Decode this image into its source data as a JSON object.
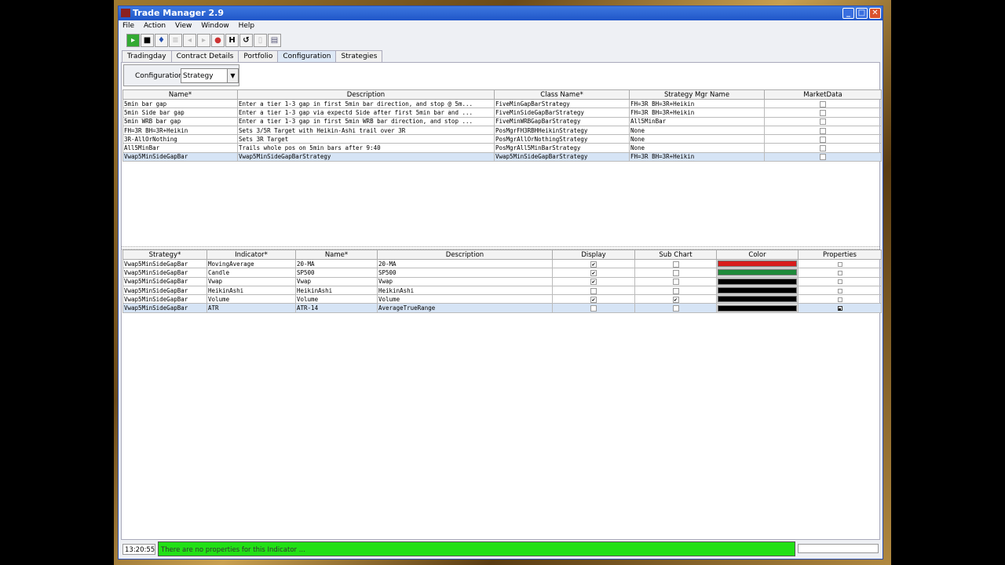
{
  "window": {
    "title": "Trade Manager 2.9"
  },
  "menu": [
    "File",
    "Action",
    "View",
    "Window",
    "Help"
  ],
  "toolbar": [
    "open-icon",
    "save-icon",
    "connect-icon",
    "delete-icon",
    "back-icon",
    "forward-icon",
    "stop-icon",
    "heikin-icon",
    "refresh-icon",
    "clipboard-icon",
    "print-icon"
  ],
  "tabs": [
    {
      "label": "Tradingday"
    },
    {
      "label": "Contract Details"
    },
    {
      "label": "Portfolio"
    },
    {
      "label": "Configuration",
      "selected": true
    },
    {
      "label": "Strategies"
    }
  ],
  "config": {
    "label": "Configuration:",
    "value": "Strategy"
  },
  "strategy_table": {
    "headers": [
      "Name*",
      "Description",
      "Class Name*",
      "Strategy Mgr Name",
      "MarketData"
    ],
    "rows": [
      [
        "5min bar gap",
        "Enter a tier 1-3 gap in first 5min bar direction, and stop @ 5m...",
        "FiveMinGapBarStrategy",
        "FH=3R BH=3R+Heikin",
        false
      ],
      [
        "5min Side bar gap",
        "Enter a tier 1-3 gap via expectd Side after first 5min bar and ...",
        "FiveMinSideGapBarStrategy",
        "FH=3R BH=3R+Heikin",
        false
      ],
      [
        "5min WRB bar gap",
        "Enter a tier 1-3 gap in first 5min WRB bar direction, and stop ...",
        "FiveMinWRBGapBarStrategy",
        "All5MinBar",
        false
      ],
      [
        "FH=3R BH=3R+Heikin",
        "Sets 3/5R Target with Heikin-Ashi trail over 3R",
        "PosMgrFH3RBHHeikinStrategy",
        "None",
        false
      ],
      [
        "3R-AllOrNothing",
        "Sets 3R Target",
        "PosMgrAllOrNothingStrategy",
        "None",
        false
      ],
      [
        "All5MinBar",
        "Trails whole pos on 5min bars after 9:40",
        "PosMgrAll5MinBarStrategy",
        "None",
        false
      ],
      [
        "Vwap5MinSideGapBar",
        "Vwap5MinSideGapBarStrategy",
        "Vwap5MinSideGapBarStrategy",
        "FH=3R BH=3R+Heikin",
        false
      ]
    ],
    "selected_row": 6
  },
  "indicator_table": {
    "headers": [
      "Strategy*",
      "Indicator*",
      "Name*",
      "Description",
      "Display",
      "Sub Chart",
      "Color",
      "Properties"
    ],
    "rows": [
      [
        "Vwap5MinSideGapBar",
        "MovingAverage",
        "20-MA",
        "20-MA",
        true,
        false,
        "#d81c1c"
      ],
      [
        "Vwap5MinSideGapBar",
        "Candle",
        "SP500",
        "SP500",
        true,
        false,
        "#1f8a3a"
      ],
      [
        "Vwap5MinSideGapBar",
        "Vwap",
        "Vwap",
        "Vwap",
        true,
        false,
        "#000000"
      ],
      [
        "Vwap5MinSideGapBar",
        "HeikinAshi",
        "HeikinAshi",
        "HeikinAshi",
        false,
        false,
        "#000000"
      ],
      [
        "Vwap5MinSideGapBar",
        "Volume",
        "Volume",
        "Volume",
        true,
        true,
        "#000000"
      ],
      [
        "Vwap5MinSideGapBar",
        "ATR",
        "ATR-14",
        "AverageTrueRange",
        false,
        false,
        "#000000"
      ]
    ],
    "selected_row": 5
  },
  "status": {
    "time": "13:20:55",
    "message": "There are no properties for this Indicator ...",
    "color": "#22e016"
  }
}
